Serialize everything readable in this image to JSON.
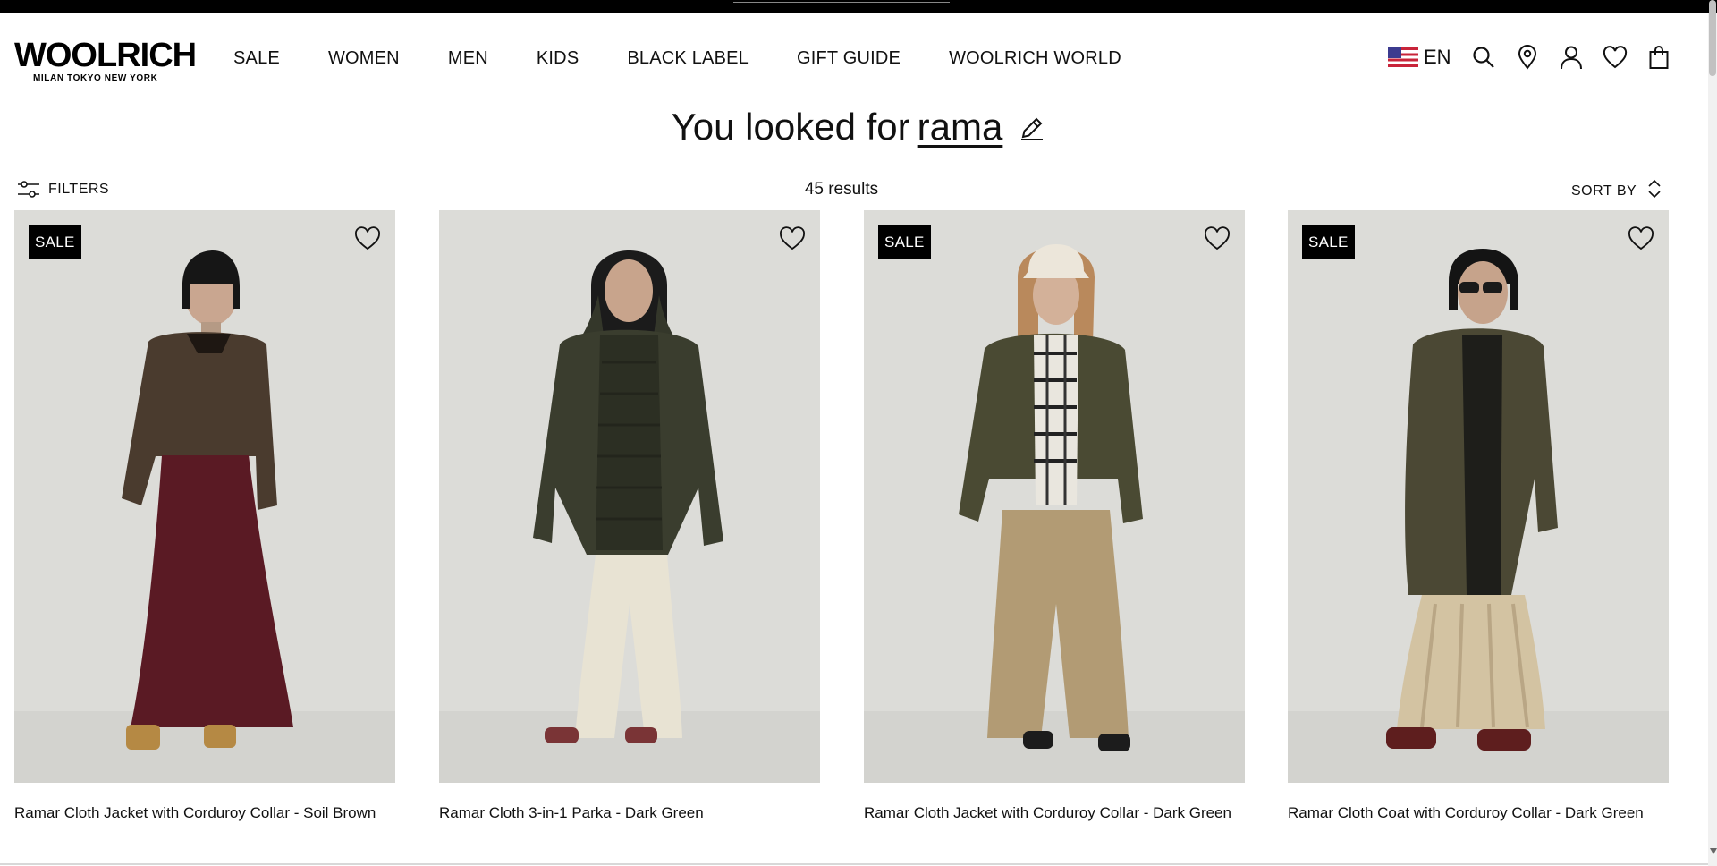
{
  "brand": {
    "name": "WOOLRICH",
    "cities": "MILAN  TOKYO  NEW YORK"
  },
  "nav": {
    "items": [
      "SALE",
      "WOMEN",
      "MEN",
      "KIDS",
      "BLACK LABEL",
      "GIFT GUIDE",
      "WOOLRICH WORLD"
    ]
  },
  "utilities": {
    "language": "EN",
    "icons": [
      "us-flag-icon",
      "search-icon",
      "store-locator-icon",
      "account-icon",
      "wishlist-icon",
      "bag-icon"
    ]
  },
  "search": {
    "prefix": "You looked for",
    "query": "rama",
    "edit_icon": "pencil-icon"
  },
  "toolbar": {
    "filters_label": "FILTERS",
    "results": "45 results",
    "sort_label": "SORT BY"
  },
  "products": [
    {
      "name": "Ramar Cloth Jacket with Corduroy Collar - Soil Brown",
      "badge": "SALE",
      "jacket_color": "#4a3b2e",
      "bottom_color": "#5a1a24"
    },
    {
      "name": "Ramar Cloth 3-in-1 Parka - Dark Green",
      "badge": "",
      "jacket_color": "#3a3d2e",
      "bottom_color": "#e8e3d3"
    },
    {
      "name": "Ramar Cloth Jacket with Corduroy Collar - Dark Green",
      "badge": "SALE",
      "jacket_color": "#4a4a33",
      "bottom_color": "#b29b74"
    },
    {
      "name": "Ramar Cloth Coat with Corduroy Collar - Dark Green",
      "badge": "SALE",
      "jacket_color": "#4b4834",
      "bottom_color": "#d3c3a2"
    }
  ],
  "colors": {
    "top_bar": "#000000",
    "photo_background": "#dcdcd8",
    "sale_badge": "#000000"
  }
}
